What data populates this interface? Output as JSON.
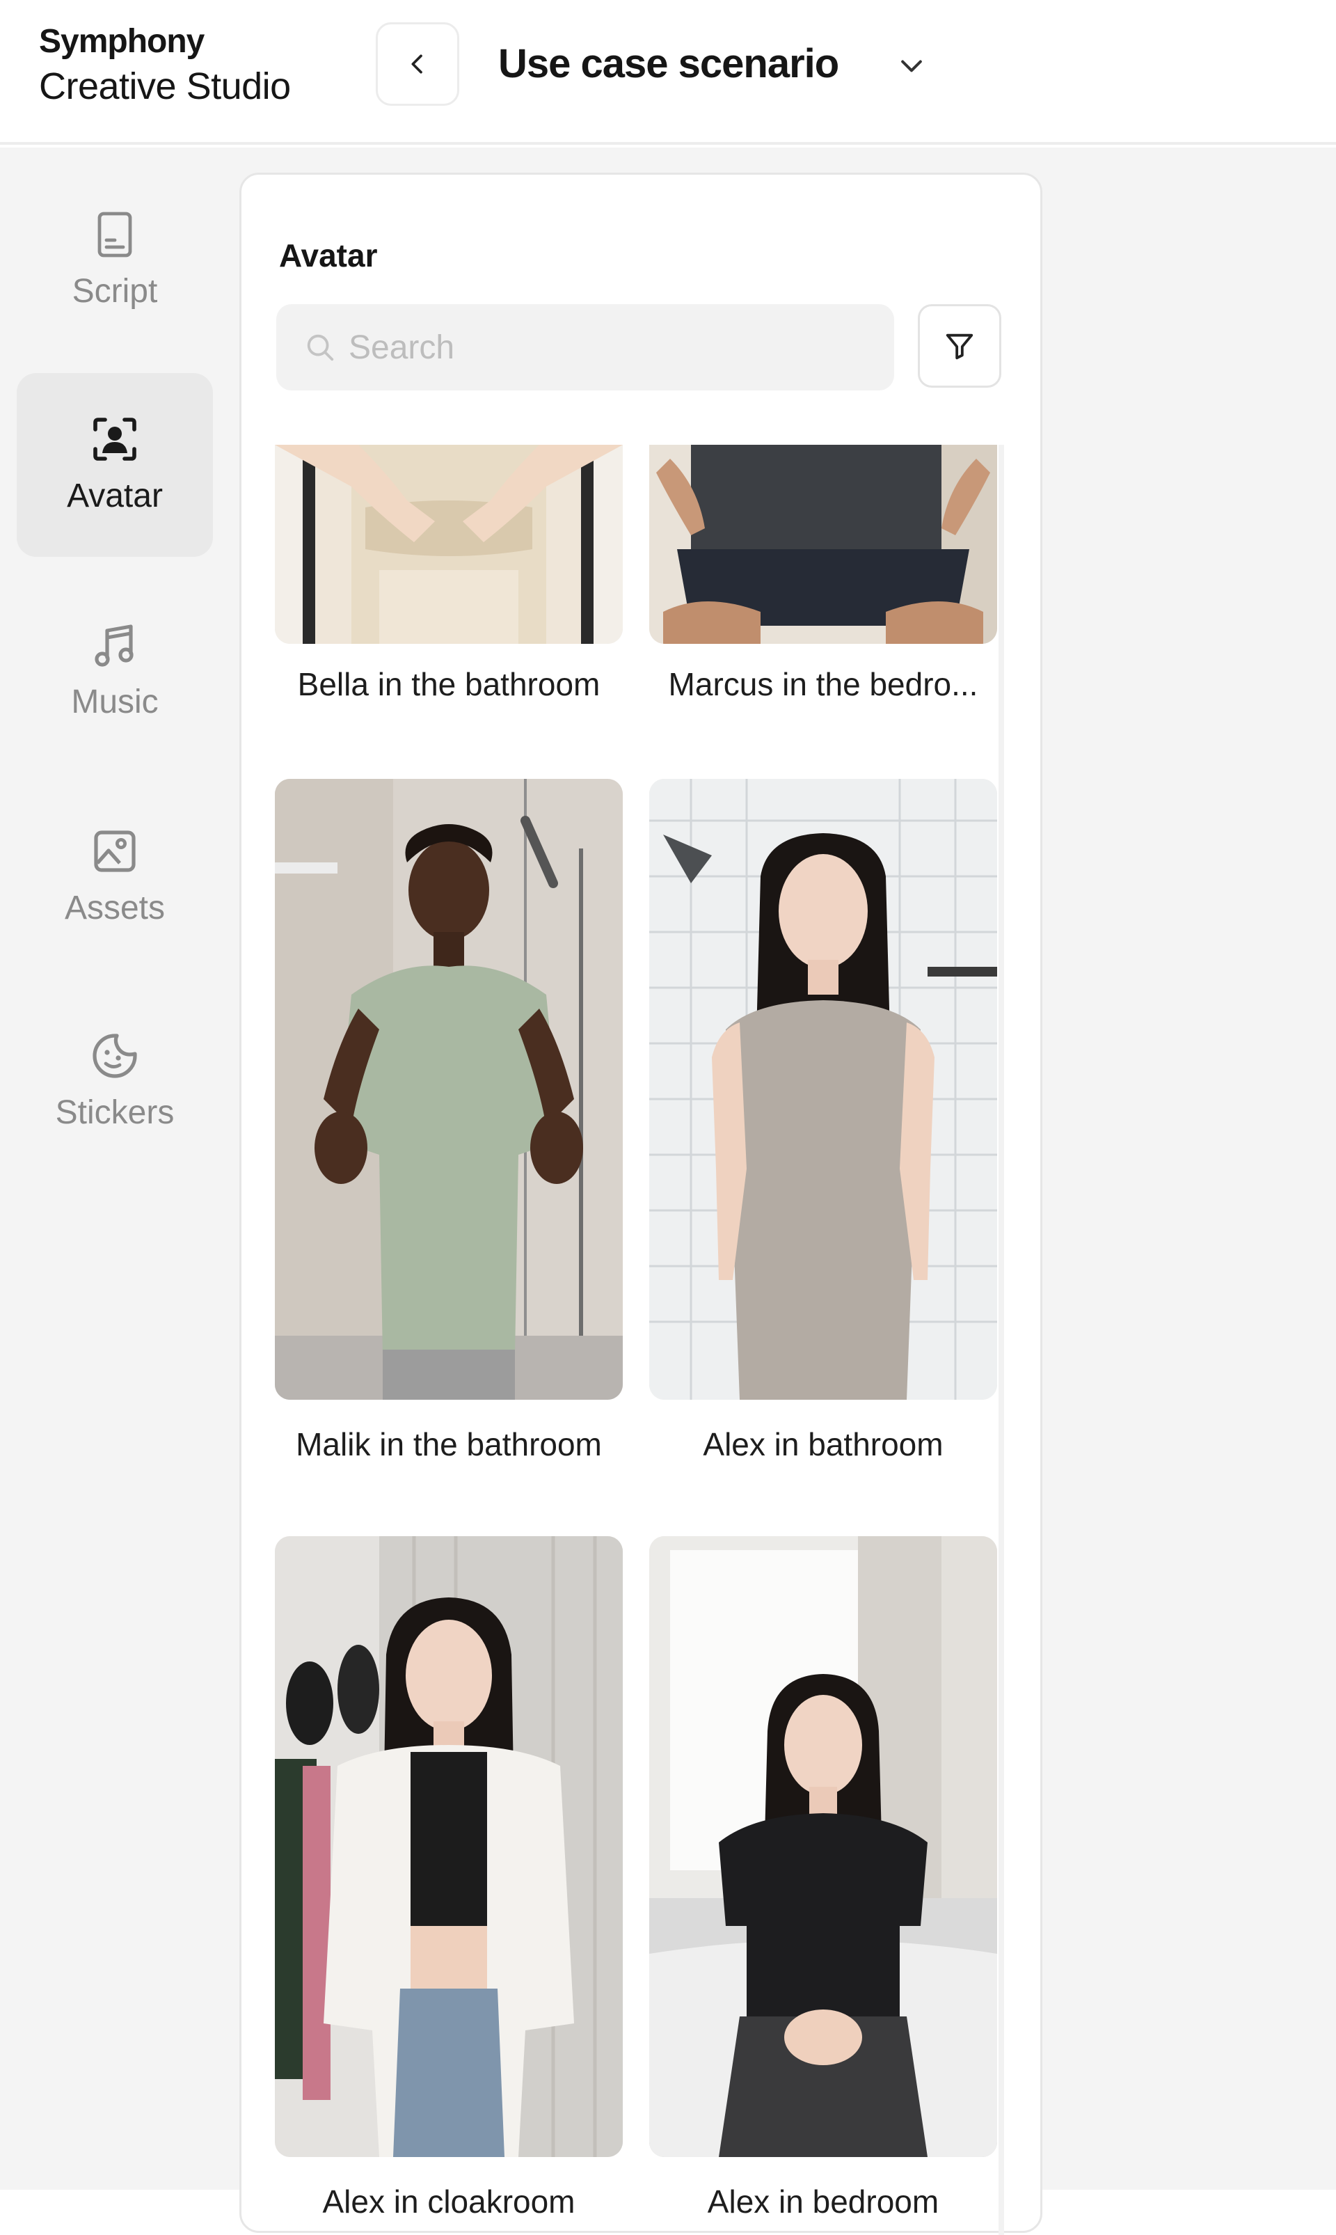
{
  "header": {
    "brand_line1": "Symphony",
    "brand_line2": "Creative Studio",
    "scenario_title": "Use case scenario"
  },
  "sidebar": {
    "items": [
      {
        "label": "Script",
        "icon": "document-icon",
        "active": false
      },
      {
        "label": "Avatar",
        "icon": "avatar-focus-icon",
        "active": true
      },
      {
        "label": "Music",
        "icon": "music-note-icon",
        "active": false
      },
      {
        "label": "Assets",
        "icon": "image-icon",
        "active": false
      },
      {
        "label": "Stickers",
        "icon": "sticker-smile-icon",
        "active": false
      }
    ]
  },
  "panel": {
    "title": "Avatar",
    "search_placeholder": "Search",
    "avatars": [
      {
        "label": "Bella in the bathroom"
      },
      {
        "label": "Marcus in the bedro..."
      },
      {
        "label": "Malik in the bathroom"
      },
      {
        "label": "Alex in bathroom"
      },
      {
        "label": "Alex in cloakroom"
      },
      {
        "label": "Alex in bedroom"
      }
    ]
  },
  "colors": {
    "active_nav_bg": "#e9e9e9",
    "inactive_text": "#8a8a8a",
    "workspace_bg": "#f4f4f4"
  }
}
